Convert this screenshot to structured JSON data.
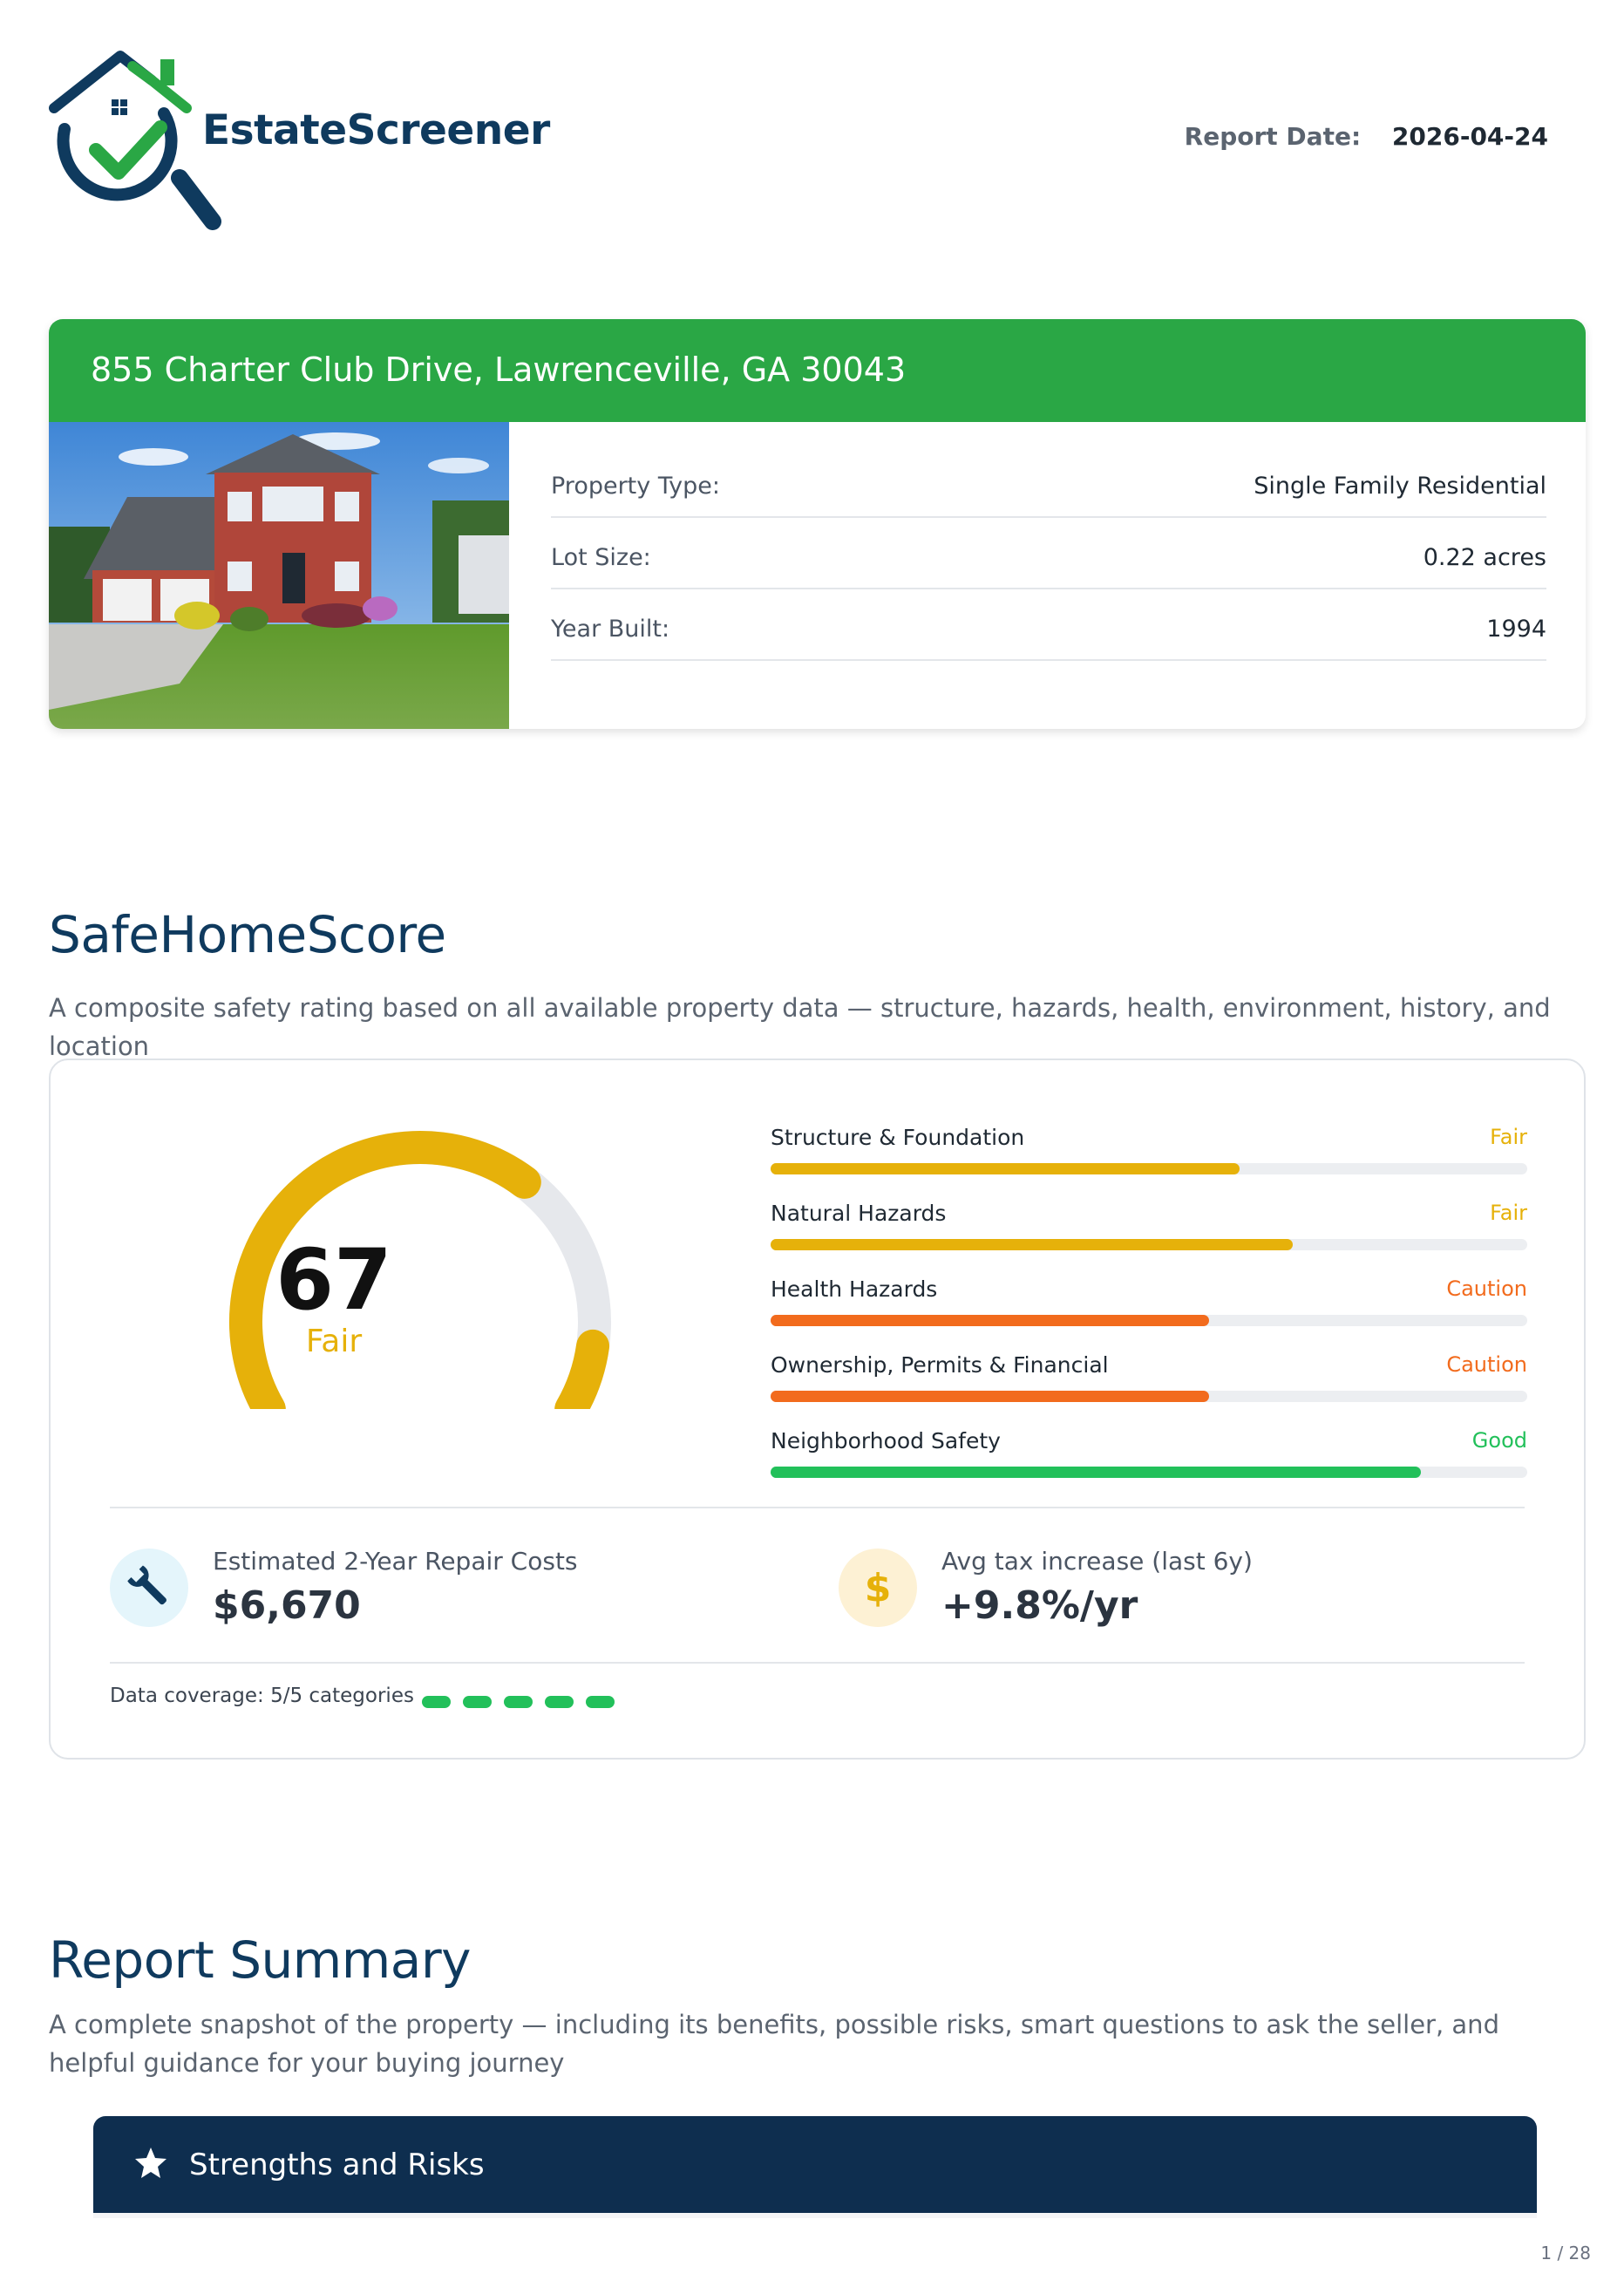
{
  "header": {
    "brand": "EstateScreener",
    "report_date_label": "Report Date:",
    "report_date": "2026-04-24"
  },
  "property": {
    "address": "855 Charter Club Drive, Lawrenceville, GA 30043",
    "details": [
      {
        "label": "Property Type:",
        "value": "Single Family Residential"
      },
      {
        "label": "Lot Size:",
        "value": "0.22 acres"
      },
      {
        "label": "Year Built:",
        "value": "1994"
      }
    ]
  },
  "safehome": {
    "title": "SafeHomeScore",
    "subtitle": "A composite safety rating based on all available property data — structure, hazards, health, environment, history, and location",
    "score": "67",
    "score_max": 100,
    "score_label": "Fair",
    "categories": [
      {
        "name": "Structure & Foundation",
        "rating": "Fair",
        "level": 0.62,
        "color": "#e6b10a"
      },
      {
        "name": "Natural Hazards",
        "rating": "Fair",
        "level": 0.69,
        "color": "#e6b10a"
      },
      {
        "name": "Health Hazards",
        "rating": "Caution",
        "level": 0.58,
        "color": "#f26b1d"
      },
      {
        "name": "Ownership, Permits & Financial",
        "rating": "Caution",
        "level": 0.58,
        "color": "#f26b1d"
      },
      {
        "name": "Neighborhood Safety",
        "rating": "Good",
        "level": 0.86,
        "color": "#22c05a"
      }
    ],
    "repair": {
      "icon": "wrench-icon",
      "label": "Estimated 2-Year Repair Costs",
      "value": "$6,670"
    },
    "tax": {
      "icon": "dollar-icon",
      "label": "Avg tax increase (last 6y)",
      "value": "+9.8%/yr"
    },
    "coverage_label": "Data coverage: 5/5 categories",
    "coverage_filled": 5,
    "coverage_total": 5
  },
  "summary": {
    "title": "Report Summary",
    "subtitle": "A complete snapshot of the property — including its benefits, possible risks, smart questions to ask the seller, and helpful guidance for your buying journey",
    "section_title": "Strengths and Risks",
    "section_icon": "star-icon"
  },
  "footer": {
    "page": "1 / 28"
  },
  "colors": {
    "brand_green": "#2aa745",
    "navy": "#0f3a5e",
    "banner": "#0e2e4f",
    "fair": "#e6b10a",
    "caution": "#f26b1d",
    "good": "#22c05a"
  }
}
